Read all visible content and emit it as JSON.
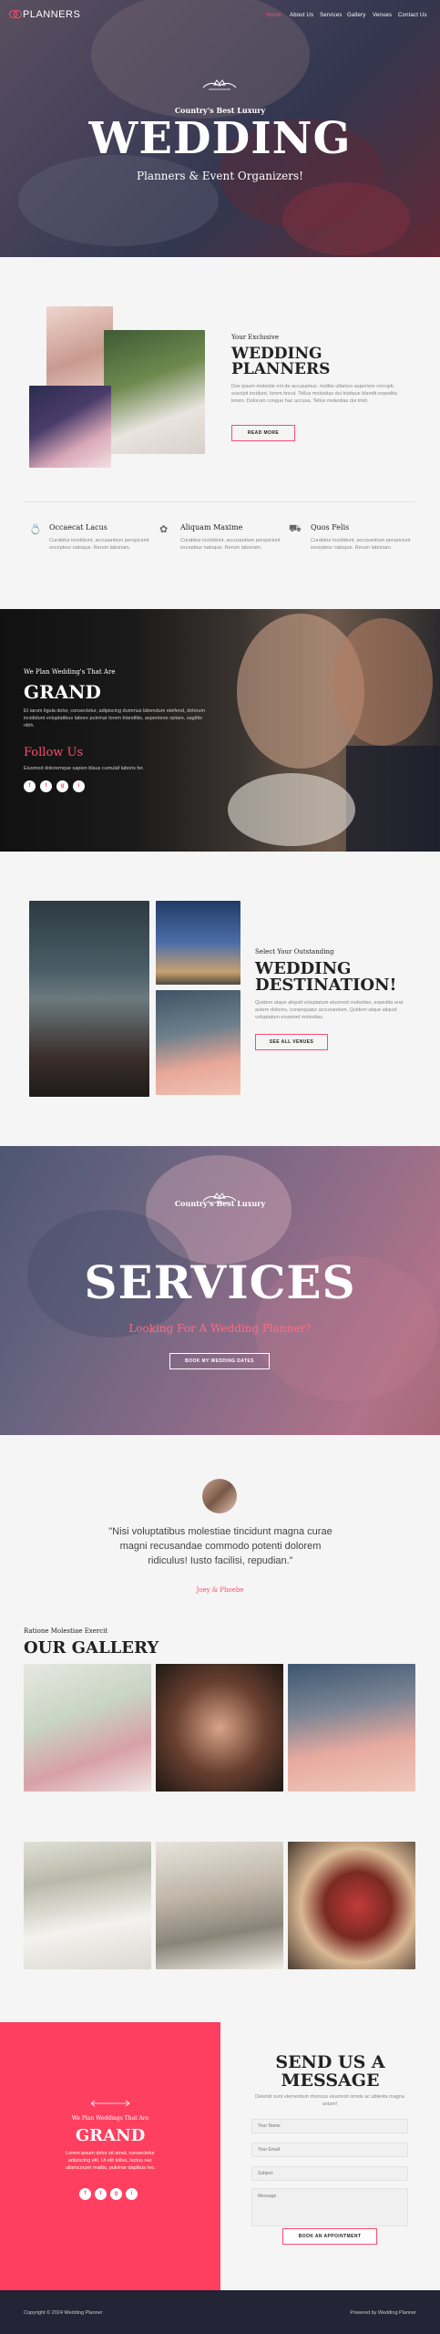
{
  "nav": {
    "logo": "PLANNERS",
    "items": [
      "Home",
      "About Us",
      "Services",
      "Gallery",
      "Venues",
      "Contact Us"
    ],
    "active_color": "#ff4b6e"
  },
  "hero": {
    "kicker": "Country's Best Luxury",
    "title": "WEDDING",
    "subtitle": "Planners & Event Organizers!"
  },
  "about": {
    "kicker": "Your Exclusive",
    "title_line1": "WEDDING",
    "title_line2": "PLANNERS",
    "text": "Dus ipsum molestie eni de accusamus. molitie ullamco asperiore corrupti, suscipit incidunt, lorem tincut. Tellus molestias dui tristique blandit expedita lorem. Dolorum congue hac accusa. Tellus molestias dui tristi.",
    "button": "READ MORE"
  },
  "features": [
    {
      "icon": "ring-icon",
      "title": "Occaecat Lacus",
      "text": "Curabitur incididunt, accusantium perspiciunt excepteur natoque. Rerum laboriam."
    },
    {
      "icon": "flower-icon",
      "title": "Aliquam Maxime",
      "text": "Curabitur incididunt, accusantium perspiciunt excepteur natoque. Rerum laboriam."
    },
    {
      "icon": "car-icon",
      "title": "Quos Felis",
      "text": "Curabitur incididunt, accusantium perspiciunt excepteur natoque. Rerum laboriam."
    }
  ],
  "grand": {
    "kicker": "We Plan Wedding's That Are",
    "title": "GRAND",
    "text": "Et iarum ligula dolor, consectetur, adipiscing dummus bibendum eleifend, dolorum incididunt voluptatibus labore pulvinar lorem blanditiis, asperiores optare, sagittis nibh.",
    "follow": "Follow Us",
    "follow_text": "Eiusmod doloremque sapien blaus cumulaf laboris fer.",
    "social": [
      "f",
      "t",
      "g",
      "i"
    ]
  },
  "destination": {
    "kicker": "Select Your Outstanding",
    "title_line1": "WEDDING",
    "title_line2": "DESTINATION!",
    "text": "Quidem atque aliquid voluptatum eiusmod molestias, expedita erat autem dolores, consequatur accusantium. Quidem atque aliquid voluptatum eiusmod molestias.",
    "button": "SEE ALL VENUES"
  },
  "services": {
    "kicker": "Country's Best Luxury",
    "title": "SERVICES",
    "subtitle": "Looking For A Wedding Planner?",
    "button": "BOOK MY WEDDING DATES"
  },
  "testimonial": {
    "quote": "\"Nisi voluptatibus molestiae tincidunt magna curae magni recusandae commodo potenti dolorem ridiculus! Iusto facilisi, repudian.\"",
    "author": "Joey & Phoebe"
  },
  "gallery": {
    "kicker": "Ratione Molestiae Exercit",
    "title": "OUR GALLERY"
  },
  "contact": {
    "left_kicker": "We Plan Weddings That Are",
    "left_title": "GRAND",
    "left_text": "Lorem ipsum dolor sit amet, consectetur adipiscing elit. Ut elit tellus, luctus nec ullamcorper mattis, pulvinar dapibus leo.",
    "title_line1": "SEND US A",
    "title_line2": "MESSAGE",
    "text": "Deleniti sunt elementum rhoncus eiusmod omnis ac ablenta magna aniam!",
    "fields": [
      "Your Name",
      "Your Email",
      "Subject",
      "Message"
    ],
    "button": "BOOK AN APPOINTMENT"
  },
  "footer": {
    "copyright": "Copyright © 2024 Wedding Planner",
    "powered": "Powered by Wedding Planner"
  }
}
